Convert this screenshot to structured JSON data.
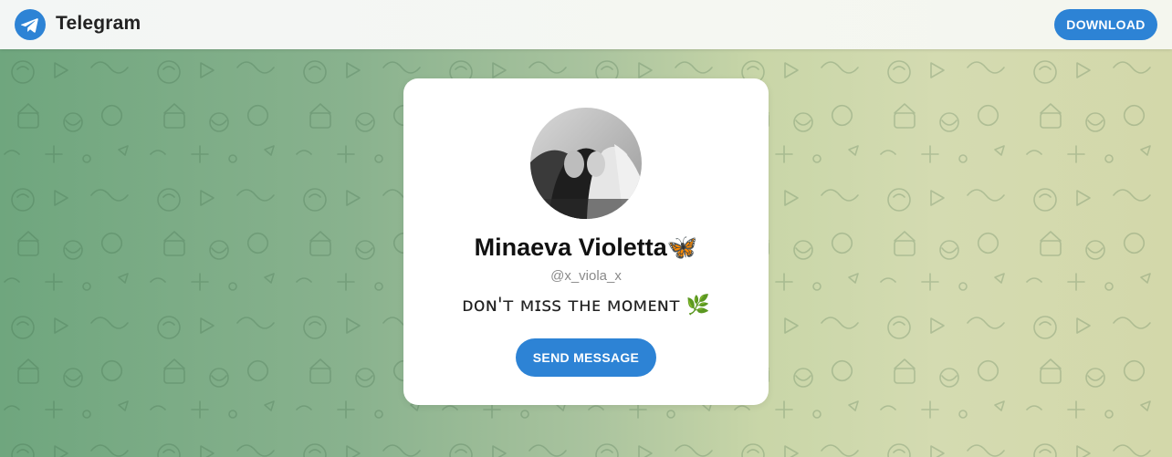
{
  "header": {
    "brand": "Telegram",
    "download_label": "DOWNLOAD"
  },
  "profile": {
    "name": "Minaeva Violetta🦋",
    "username": "@x_viola_x",
    "bio": "ᴅᴏɴ'ᴛ ᴍɪss ᴛʜᴇ ᴍᴏᴍᴇɴᴛ 🌿",
    "send_label": "SEND MESSAGE"
  },
  "colors": {
    "accent": "#2d83d5",
    "card_bg": "#ffffff",
    "bg_left": "#6fa67e",
    "bg_right": "#d3d8aa"
  },
  "icons": {
    "logo": "telegram-logo-icon",
    "avatar": "profile-photo"
  }
}
